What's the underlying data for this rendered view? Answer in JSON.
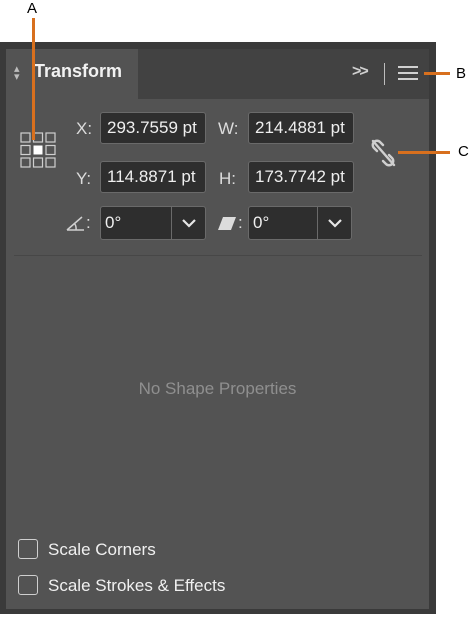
{
  "panel": {
    "title": "Transform"
  },
  "transform": {
    "x_label": "X:",
    "x_value": "293.7559 pt",
    "y_label": "Y:",
    "y_value": "114.8871 pt",
    "w_label": "W:",
    "w_value": "214.4881 pt",
    "h_label": "H:",
    "h_value": "173.7742 pt",
    "rotate_value": "0°",
    "shear_value": "0°"
  },
  "shape": {
    "empty_message": "No Shape Properties"
  },
  "options": {
    "scale_corners_label": "Scale Corners",
    "scale_corners_checked": false,
    "scale_strokes_label": "Scale Strokes & Effects",
    "scale_strokes_checked": false
  },
  "callouts": {
    "a": "A",
    "b": "B",
    "c": "C"
  },
  "colors": {
    "panel_bg": "#535353",
    "field_bg": "#2e2e2e",
    "callout": "#d8701e"
  },
  "icons": [
    "reference-point-icon",
    "constrain-proportions-link-icon",
    "rotate-angle-icon",
    "shear-icon",
    "chevron-down-icon",
    "collapse-panel-icon",
    "panel-menu-icon"
  ]
}
